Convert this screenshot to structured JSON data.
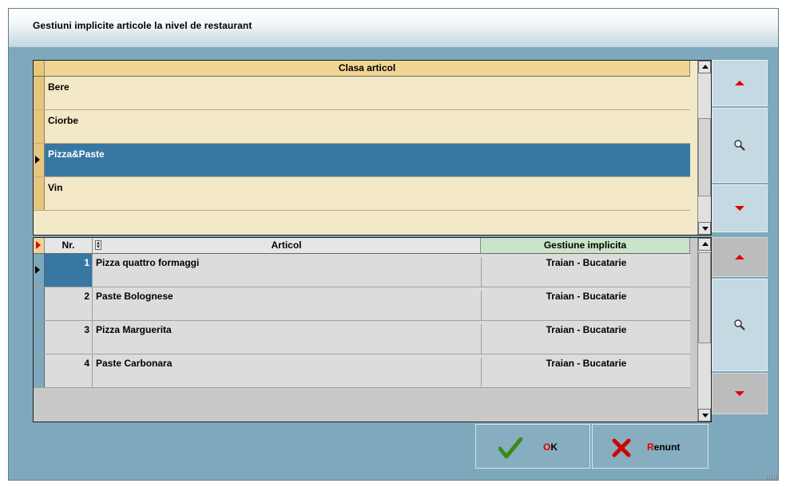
{
  "window": {
    "title": "Gestiuni implicite articole la nivel de restaurant"
  },
  "upper_grid": {
    "column_header": "Clasa articol",
    "rows": [
      {
        "label": "Bere",
        "selected": false
      },
      {
        "label": "Ciorbe",
        "selected": false
      },
      {
        "label": "Pizza&Paste",
        "selected": true
      },
      {
        "label": "Vin",
        "selected": false
      }
    ]
  },
  "lower_grid": {
    "columns": {
      "nr": "Nr.",
      "articol": "Articol",
      "gestiune": "Gestiune implicita"
    },
    "rows": [
      {
        "nr": "1",
        "articol": "Pizza quattro formaggi",
        "gestiune": "Traian - Bucatarie",
        "selected": true
      },
      {
        "nr": "2",
        "articol": "Paste Bolognese",
        "gestiune": "Traian - Bucatarie",
        "selected": false
      },
      {
        "nr": "3",
        "articol": "Pizza Marguerita",
        "gestiune": "Traian - Bucatarie",
        "selected": false
      },
      {
        "nr": "4",
        "articol": "Paste Carbonara",
        "gestiune": "Traian - Bucatarie",
        "selected": false
      }
    ]
  },
  "buttons": {
    "ok": {
      "hotkey": "O",
      "rest": "K"
    },
    "cancel": {
      "hotkey": "R",
      "rest": "enunt"
    }
  },
  "icons": {
    "nav_up": "arrow-up-icon",
    "nav_down": "arrow-down-icon",
    "search": "magnifier-icon",
    "ok": "checkmark-icon",
    "cancel": "x-icon"
  },
  "colors": {
    "accent_red": "#e00000",
    "selection": "#3977a3",
    "check_green": "#3a8a1a",
    "background": "#7ea9bc"
  }
}
